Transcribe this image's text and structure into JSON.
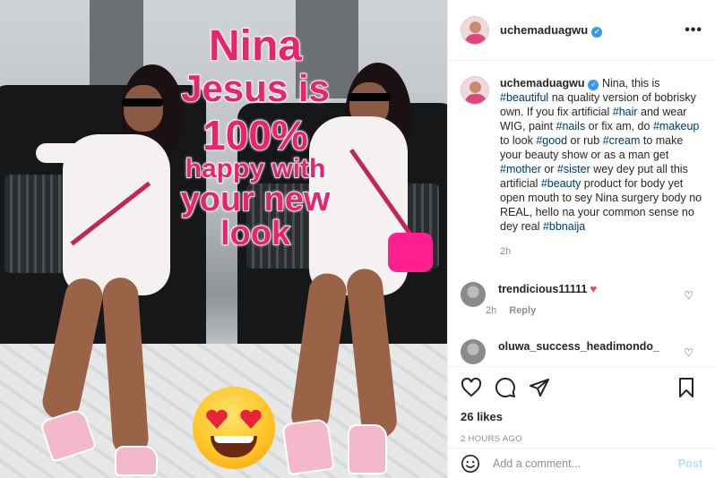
{
  "media": {
    "overlay_lines": [
      "Nina",
      "Jesus is",
      "100%",
      "happy with",
      "your new",
      "look"
    ],
    "emoji": "heart-eyes-emoji"
  },
  "header": {
    "username": "uchemaduagwu",
    "more_icon": "more-horizontal-icon"
  },
  "caption": {
    "username": "uchemaduagwu",
    "segments": [
      {
        "t": " Nina, this is "
      },
      {
        "t": "#beautiful",
        "tag": true
      },
      {
        "t": " na quality version of bobrisky own. If you fix artificial "
      },
      {
        "t": "#hair",
        "tag": true
      },
      {
        "t": " and wear WIG, paint "
      },
      {
        "t": "#nails",
        "tag": true
      },
      {
        "t": " or fix am, do "
      },
      {
        "t": "#makeup",
        "tag": true
      },
      {
        "t": " to look "
      },
      {
        "t": "#good",
        "tag": true
      },
      {
        "t": " or rub "
      },
      {
        "t": "#cream",
        "tag": true
      },
      {
        "t": " to make your beauty show or as a man get "
      },
      {
        "t": "#mother",
        "tag": true
      },
      {
        "t": " or "
      },
      {
        "t": "#sister",
        "tag": true
      },
      {
        "t": " wey dey put all this artificial "
      },
      {
        "t": "#beauty",
        "tag": true
      },
      {
        "t": " product for body yet open mouth to sey Nina surgery body no REAL, hello na your common sense no dey real "
      },
      {
        "t": "#bbnaija",
        "tag": true
      }
    ],
    "time": "2h"
  },
  "comments": [
    {
      "username": "trendicious11111",
      "emoji": "♥",
      "time": "2h",
      "reply": "Reply"
    },
    {
      "username": "oluwa_success_headimondo_"
    }
  ],
  "actions": {
    "like_icon": "heart-outline-icon",
    "comment_icon": "comment-icon",
    "share_icon": "paper-plane-icon",
    "save_icon": "bookmark-icon",
    "likes": "26 likes",
    "posted": "2 HOURS AGO"
  },
  "add_comment": {
    "placeholder": "Add a comment...",
    "post_label": "Post",
    "emoji_icon": "smiley-icon"
  },
  "colors": {
    "overlay_text": "#e8246e",
    "hashtag": "#00376b",
    "verified": "#3897f0",
    "post_disabled": "#b2dffc",
    "heart": "#ed4956"
  }
}
